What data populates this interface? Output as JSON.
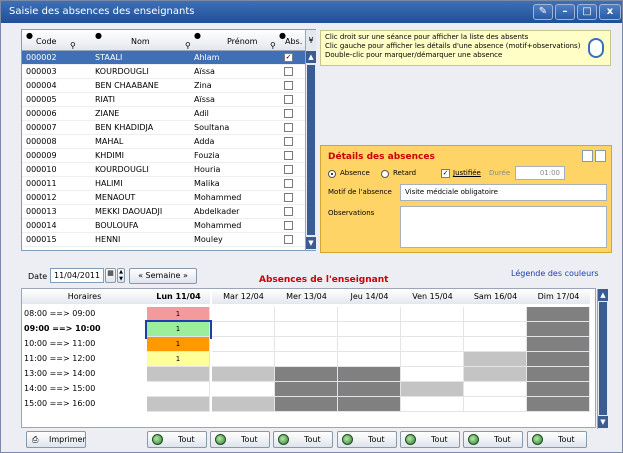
{
  "window": {
    "title": "Saisie des absences des enseignants"
  },
  "table": {
    "headers": {
      "code": "Code",
      "nom": "Nom",
      "prenom": "Prénom",
      "abs": "Abs."
    },
    "rows": [
      {
        "code": "000002",
        "nom": "STAALI",
        "prenom": "Ahlam",
        "abs": true,
        "selected": true
      },
      {
        "code": "000003",
        "nom": "KOURDOUGLI",
        "prenom": "Aïssa",
        "abs": false
      },
      {
        "code": "000004",
        "nom": "BEN CHAABANE",
        "prenom": "Zina",
        "abs": false
      },
      {
        "code": "000005",
        "nom": "RIATI",
        "prenom": "Aïssa",
        "abs": false
      },
      {
        "code": "000006",
        "nom": "ZIANE",
        "prenom": "Adil",
        "abs": false
      },
      {
        "code": "000007",
        "nom": "BEN KHADIDJA",
        "prenom": "Soultana",
        "abs": false
      },
      {
        "code": "000008",
        "nom": "MAHAL",
        "prenom": "Adda",
        "abs": false
      },
      {
        "code": "000009",
        "nom": "KHDIMI",
        "prenom": "Fouzia",
        "abs": false
      },
      {
        "code": "000010",
        "nom": "KOURDOUGLI",
        "prenom": "Houria",
        "abs": false
      },
      {
        "code": "000011",
        "nom": "HALIMI",
        "prenom": "Malika",
        "abs": false
      },
      {
        "code": "000012",
        "nom": "MENAOUT",
        "prenom": "Mohammed",
        "abs": false
      },
      {
        "code": "000013",
        "nom": "MEKKI DAOUADJI",
        "prenom": "Abdelkader",
        "abs": false
      },
      {
        "code": "000014",
        "nom": "BOULOUFA",
        "prenom": "Mohammed",
        "abs": false
      },
      {
        "code": "000015",
        "nom": "HENNI",
        "prenom": "Mouley",
        "abs": false
      }
    ]
  },
  "hint": {
    "line1": "Clic droit sur une séance pour afficher la liste des absents",
    "line2": "Clic gauche pour afficher les détails d'une absence (motif+observations)",
    "line3": "Double-clic pour marquer/démarquer une absence"
  },
  "details": {
    "title": "Détails des absences",
    "absence_label": "Absence",
    "retard_label": "Retard",
    "justifiee_label": "Justifiée",
    "duree_label": "Durée",
    "duree_value": "01:00",
    "motif_label": "Motif de l'absence",
    "motif_value": "Visite médciale obligatoire",
    "obs_label": "Observations",
    "obs_value": ""
  },
  "lower": {
    "date_label": "Date",
    "date_value": "11/04/2011",
    "semaine_label": "Semaine",
    "section_title": "Absences de l'enseignant",
    "legend_link": "Légende des couleurs"
  },
  "schedule": {
    "col0": "Horaires",
    "days": [
      "Lun 11/04",
      "Mar 12/04",
      "Mer 13/04",
      "Jeu 14/04",
      "Ven 15/04",
      "Sam 16/04",
      "Dim 17/04"
    ],
    "times": [
      "08:00 ==> 09:00",
      "09:00 ==> 10:00",
      "10:00 ==> 11:00",
      "11:00 ==> 12:00",
      "13:00 ==> 14:00",
      "14:00 ==> 15:00",
      "15:00 ==> 16:00"
    ],
    "monday_values": [
      "1",
      "1",
      "1",
      "1",
      "",
      "",
      ""
    ]
  },
  "buttons": {
    "imprimer": "Imprimer",
    "tout": "Tout"
  },
  "colors": {
    "pink": "#f59a9a",
    "green": "#9bef9b",
    "orange": "#ff9900",
    "yellow": "#ffff99",
    "grey": "#c4c4c4",
    "dark": "#808080"
  }
}
